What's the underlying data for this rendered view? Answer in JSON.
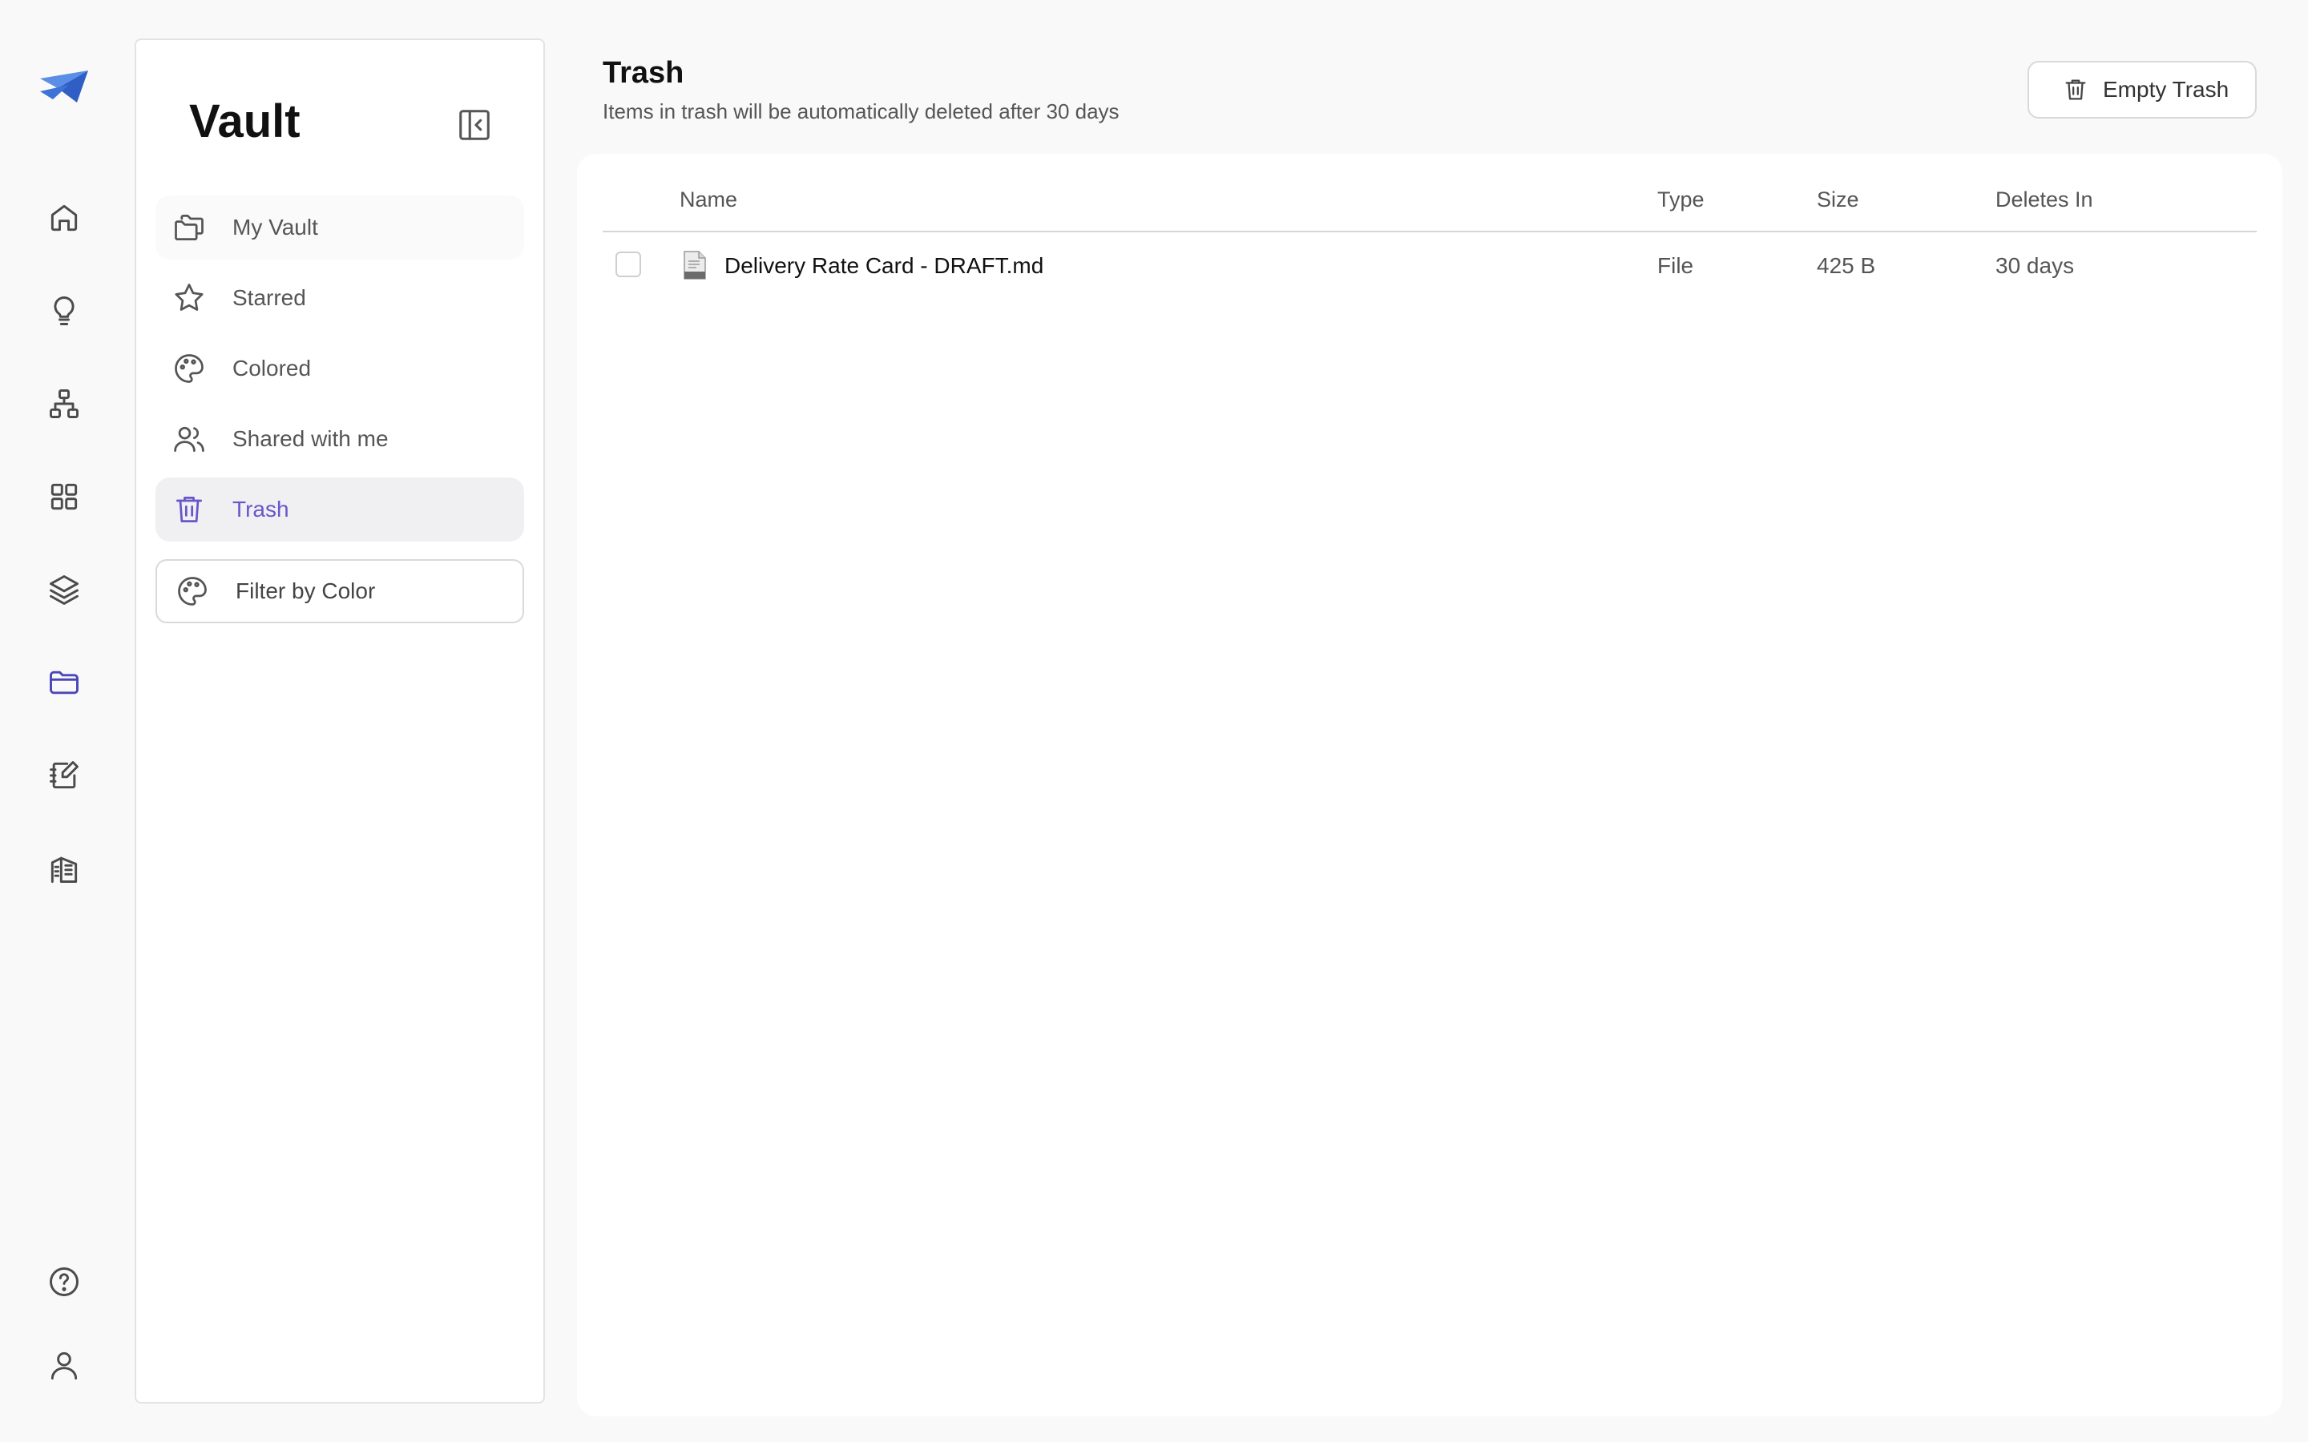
{
  "rail": {
    "items": [
      "home",
      "ideas",
      "hierarchy",
      "apps",
      "layers",
      "vault",
      "notes",
      "buildings"
    ],
    "active": "vault",
    "accent_color": "#4a47b8"
  },
  "sidebar": {
    "title": "Vault",
    "items": [
      {
        "label": "My Vault",
        "icon": "folders-icon"
      },
      {
        "label": "Starred",
        "icon": "star-icon"
      },
      {
        "label": "Colored",
        "icon": "palette-icon"
      },
      {
        "label": "Shared with me",
        "icon": "users-icon"
      },
      {
        "label": "Trash",
        "icon": "trash-icon",
        "active": true
      }
    ],
    "filter_label": "Filter by Color",
    "active_color": "#6a55c9"
  },
  "main": {
    "title": "Trash",
    "subtitle": "Items in trash will be automatically deleted after 30 days",
    "empty_trash_label": "Empty Trash",
    "table": {
      "headers": {
        "name": "Name",
        "type": "Type",
        "size": "Size",
        "deletes_in": "Deletes In"
      },
      "rows": [
        {
          "name": "Delivery Rate Card - DRAFT.md",
          "type": "File",
          "size": "425 B",
          "deletes_in": "30 days",
          "selected": false
        }
      ]
    }
  }
}
